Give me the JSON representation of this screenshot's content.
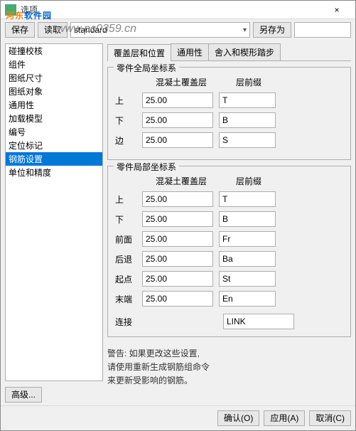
{
  "titlebar": {
    "title": "选项",
    "close": "×"
  },
  "watermark": {
    "brand1": "河东",
    "brand2": "软件园",
    "url": "www.pc0359.cn"
  },
  "toolbar": {
    "save": "保存",
    "load": "读取",
    "preset": "standard",
    "saveas": "另存为",
    "saveas_value": ""
  },
  "sidebar": {
    "items": [
      "碰撞校核",
      "组件",
      "图纸尺寸",
      "图纸对象",
      "通用性",
      "加载模型",
      "编号",
      "定位标记",
      "钢筋设置",
      "单位和精度"
    ],
    "selected": 8
  },
  "tabs": {
    "items": [
      "覆盖层和位置",
      "通用性",
      "舍入和楔形踏步"
    ],
    "active": 0
  },
  "global": {
    "legend": "零件全局坐标系",
    "col1": "混凝土覆盖层",
    "col2": "层前缀",
    "rows": [
      {
        "label": "上",
        "v": "25.00",
        "p": "T"
      },
      {
        "label": "下",
        "v": "25.00",
        "p": "B"
      },
      {
        "label": "边",
        "v": "25.00",
        "p": "S"
      }
    ]
  },
  "local": {
    "legend": "零件局部坐标系",
    "col1": "混凝土覆盖层",
    "col2": "层前缀",
    "rows": [
      {
        "label": "上",
        "v": "25.00",
        "p": "T"
      },
      {
        "label": "下",
        "v": "25.00",
        "p": "B"
      },
      {
        "label": "前面",
        "v": "25.00",
        "p": "Fr"
      },
      {
        "label": "后退",
        "v": "25.00",
        "p": "Ba"
      },
      {
        "label": "起点",
        "v": "25.00",
        "p": "St"
      },
      {
        "label": "末端",
        "v": "25.00",
        "p": "En"
      }
    ],
    "link_label": "连接",
    "link_value": "LINK"
  },
  "warning": {
    "l1": "警告: 如果更改这些设置,",
    "l2": "请使用重新生成钢筋组命令",
    "l3": "来更新受影响的钢筋。"
  },
  "buttons": {
    "advanced": "高级...",
    "ok": "确认(O)",
    "apply": "应用(A)",
    "cancel": "取消(C)"
  }
}
